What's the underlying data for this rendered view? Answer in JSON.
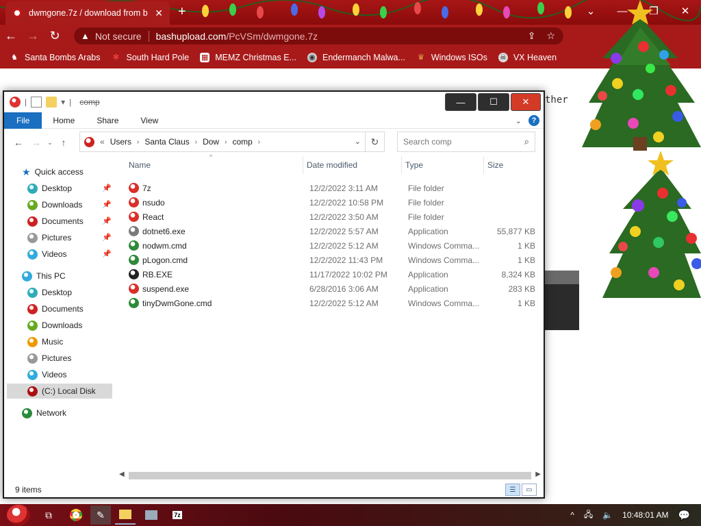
{
  "browser": {
    "tab_title": "dwmgone.7z / download from b",
    "tab_close": "✕",
    "new_tab": "+",
    "url_warning": "Not secure",
    "url_host": "bashupload.com",
    "url_path": "/PcVSm/dwmgone.7z",
    "bookmarks": [
      {
        "label": "Santa Bombs Arabs",
        "icon": "sleigh-icon"
      },
      {
        "label": "South Hard Pole",
        "icon": "snowflake-icon"
      },
      {
        "label": "MEMZ Christmas E...",
        "icon": "memz-icon"
      },
      {
        "label": "Endermanch Malwa...",
        "icon": "wolf-icon"
      },
      {
        "label": "Windows ISOs",
        "icon": "gift-icon"
      },
      {
        "label": "VX Heaven",
        "icon": "skull-icon"
      }
    ],
    "page_text_fragment": "ther"
  },
  "explorer": {
    "title": "comp",
    "ribbon_tabs": [
      "File",
      "Home",
      "Share",
      "View"
    ],
    "breadcrumb": [
      "Users",
      "Santa Claus",
      "Dow",
      "comp"
    ],
    "breadcrumb_prefix": "«",
    "search_placeholder": "Search comp",
    "nav": {
      "quick_access": "Quick access",
      "quick_items": [
        "Desktop",
        "Downloads",
        "Documents",
        "Pictures",
        "Videos"
      ],
      "this_pc": "This PC",
      "pc_items": [
        "Desktop",
        "Documents",
        "Downloads",
        "Music",
        "Pictures",
        "Videos",
        "(C:) Local Disk"
      ],
      "network": "Network"
    },
    "columns": {
      "name": "Name",
      "date": "Date modified",
      "type": "Type",
      "size": "Size"
    },
    "files": [
      {
        "name": "7z",
        "date": "12/2/2022 3:11 AM",
        "type": "File folder",
        "size": "",
        "icon_color": "#d9302a"
      },
      {
        "name": "nsudo",
        "date": "12/2/2022 10:58 PM",
        "type": "File folder",
        "size": "",
        "icon_color": "#d9302a"
      },
      {
        "name": "React",
        "date": "12/2/2022 3:50 AM",
        "type": "File folder",
        "size": "",
        "icon_color": "#d9302a"
      },
      {
        "name": "dotnet6.exe",
        "date": "12/2/2022 5:57 AM",
        "type": "Application",
        "size": "55,877 KB",
        "icon_color": "#7a7a7a"
      },
      {
        "name": "nodwm.cmd",
        "date": "12/2/2022 5:12 AM",
        "type": "Windows Comma...",
        "size": "1 KB",
        "icon_color": "#2f8a3a"
      },
      {
        "name": "pLogon.cmd",
        "date": "12/2/2022 11:43 PM",
        "type": "Windows Comma...",
        "size": "1 KB",
        "icon_color": "#2f8a3a"
      },
      {
        "name": "RB.EXE",
        "date": "11/17/2022 10:02 PM",
        "type": "Application",
        "size": "8,324 KB",
        "icon_color": "#222222"
      },
      {
        "name": "suspend.exe",
        "date": "6/28/2016 3:06 AM",
        "type": "Application",
        "size": "283 KB",
        "icon_color": "#d9302a"
      },
      {
        "name": "tinyDwmGone.cmd",
        "date": "12/2/2022 5:12 AM",
        "type": "Windows Comma...",
        "size": "1 KB",
        "icon_color": "#2f8a3a"
      }
    ],
    "status": "9 items"
  },
  "taskbar": {
    "clock": "10:48:01 AM"
  }
}
